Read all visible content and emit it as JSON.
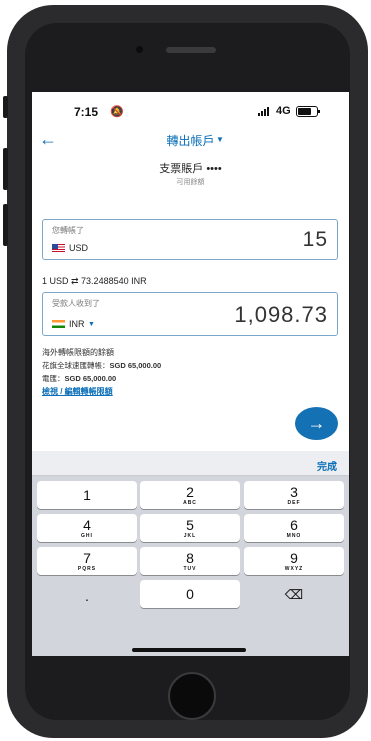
{
  "status": {
    "time": "7:15",
    "network": "4G"
  },
  "nav": {
    "title": "轉出帳戶",
    "back_icon": "arrow-left-icon"
  },
  "account": {
    "name": "支票賬戶 ••••",
    "available_label": "可用餘額"
  },
  "from_field": {
    "label": "您轉帳了",
    "currency": "USD",
    "amount": "15"
  },
  "rate": "1 USD ⇄ 73.2488540 INR",
  "to_field": {
    "label": "受款人收到了",
    "currency": "INR",
    "amount": "1,098.73"
  },
  "limits": {
    "title": "海外轉帳限額的餘額",
    "line1_label": "花旗全球速匯轉帳：",
    "line1_value": "SGD 65,000.00",
    "line2_label": "電匯：",
    "line2_value": "SGD 65,000.00",
    "edit_link": "檢視 / 編輯轉帳限額"
  },
  "keyboard": {
    "done": "完成",
    "keys": [
      {
        "digit": "1",
        "letters": ""
      },
      {
        "digit": "2",
        "letters": "ABC"
      },
      {
        "digit": "3",
        "letters": "DEF"
      },
      {
        "digit": "4",
        "letters": "GHI"
      },
      {
        "digit": "5",
        "letters": "JKL"
      },
      {
        "digit": "6",
        "letters": "MNO"
      },
      {
        "digit": "7",
        "letters": "PQRS"
      },
      {
        "digit": "8",
        "letters": "TUV"
      },
      {
        "digit": "9",
        "letters": "WXYZ"
      }
    ],
    "dot": ".",
    "zero": "0"
  },
  "colors": {
    "accent": "#0a6fb8",
    "button": "#1471b3"
  }
}
